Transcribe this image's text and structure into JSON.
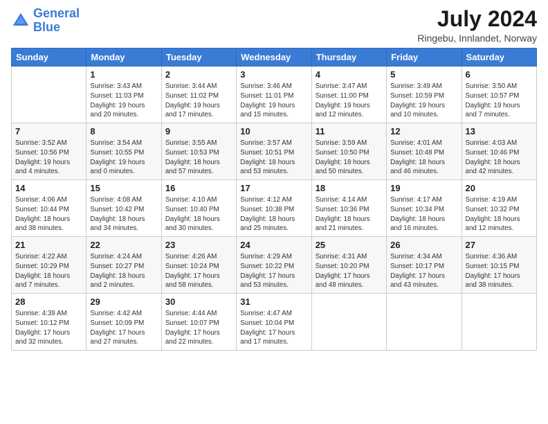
{
  "header": {
    "logo_line1": "General",
    "logo_line2": "Blue",
    "month_year": "July 2024",
    "location": "Ringebu, Innlandet, Norway"
  },
  "weekdays": [
    "Sunday",
    "Monday",
    "Tuesday",
    "Wednesday",
    "Thursday",
    "Friday",
    "Saturday"
  ],
  "weeks": [
    [
      {
        "date": "",
        "info": ""
      },
      {
        "date": "1",
        "info": "Sunrise: 3:43 AM\nSunset: 11:03 PM\nDaylight: 19 hours\nand 20 minutes."
      },
      {
        "date": "2",
        "info": "Sunrise: 3:44 AM\nSunset: 11:02 PM\nDaylight: 19 hours\nand 17 minutes."
      },
      {
        "date": "3",
        "info": "Sunrise: 3:46 AM\nSunset: 11:01 PM\nDaylight: 19 hours\nand 15 minutes."
      },
      {
        "date": "4",
        "info": "Sunrise: 3:47 AM\nSunset: 11:00 PM\nDaylight: 19 hours\nand 12 minutes."
      },
      {
        "date": "5",
        "info": "Sunrise: 3:49 AM\nSunset: 10:59 PM\nDaylight: 19 hours\nand 10 minutes."
      },
      {
        "date": "6",
        "info": "Sunrise: 3:50 AM\nSunset: 10:57 PM\nDaylight: 19 hours\nand 7 minutes."
      }
    ],
    [
      {
        "date": "7",
        "info": "Sunrise: 3:52 AM\nSunset: 10:56 PM\nDaylight: 19 hours\nand 4 minutes."
      },
      {
        "date": "8",
        "info": "Sunrise: 3:54 AM\nSunset: 10:55 PM\nDaylight: 19 hours\nand 0 minutes."
      },
      {
        "date": "9",
        "info": "Sunrise: 3:55 AM\nSunset: 10:53 PM\nDaylight: 18 hours\nand 57 minutes."
      },
      {
        "date": "10",
        "info": "Sunrise: 3:57 AM\nSunset: 10:51 PM\nDaylight: 18 hours\nand 53 minutes."
      },
      {
        "date": "11",
        "info": "Sunrise: 3:59 AM\nSunset: 10:50 PM\nDaylight: 18 hours\nand 50 minutes."
      },
      {
        "date": "12",
        "info": "Sunrise: 4:01 AM\nSunset: 10:48 PM\nDaylight: 18 hours\nand 46 minutes."
      },
      {
        "date": "13",
        "info": "Sunrise: 4:03 AM\nSunset: 10:46 PM\nDaylight: 18 hours\nand 42 minutes."
      }
    ],
    [
      {
        "date": "14",
        "info": "Sunrise: 4:06 AM\nSunset: 10:44 PM\nDaylight: 18 hours\nand 38 minutes."
      },
      {
        "date": "15",
        "info": "Sunrise: 4:08 AM\nSunset: 10:42 PM\nDaylight: 18 hours\nand 34 minutes."
      },
      {
        "date": "16",
        "info": "Sunrise: 4:10 AM\nSunset: 10:40 PM\nDaylight: 18 hours\nand 30 minutes."
      },
      {
        "date": "17",
        "info": "Sunrise: 4:12 AM\nSunset: 10:38 PM\nDaylight: 18 hours\nand 25 minutes."
      },
      {
        "date": "18",
        "info": "Sunrise: 4:14 AM\nSunset: 10:36 PM\nDaylight: 18 hours\nand 21 minutes."
      },
      {
        "date": "19",
        "info": "Sunrise: 4:17 AM\nSunset: 10:34 PM\nDaylight: 18 hours\nand 16 minutes."
      },
      {
        "date": "20",
        "info": "Sunrise: 4:19 AM\nSunset: 10:32 PM\nDaylight: 18 hours\nand 12 minutes."
      }
    ],
    [
      {
        "date": "21",
        "info": "Sunrise: 4:22 AM\nSunset: 10:29 PM\nDaylight: 18 hours\nand 7 minutes."
      },
      {
        "date": "22",
        "info": "Sunrise: 4:24 AM\nSunset: 10:27 PM\nDaylight: 18 hours\nand 2 minutes."
      },
      {
        "date": "23",
        "info": "Sunrise: 4:26 AM\nSunset: 10:24 PM\nDaylight: 17 hours\nand 58 minutes."
      },
      {
        "date": "24",
        "info": "Sunrise: 4:29 AM\nSunset: 10:22 PM\nDaylight: 17 hours\nand 53 minutes."
      },
      {
        "date": "25",
        "info": "Sunrise: 4:31 AM\nSunset: 10:20 PM\nDaylight: 17 hours\nand 48 minutes."
      },
      {
        "date": "26",
        "info": "Sunrise: 4:34 AM\nSunset: 10:17 PM\nDaylight: 17 hours\nand 43 minutes."
      },
      {
        "date": "27",
        "info": "Sunrise: 4:36 AM\nSunset: 10:15 PM\nDaylight: 17 hours\nand 38 minutes."
      }
    ],
    [
      {
        "date": "28",
        "info": "Sunrise: 4:39 AM\nSunset: 10:12 PM\nDaylight: 17 hours\nand 32 minutes."
      },
      {
        "date": "29",
        "info": "Sunrise: 4:42 AM\nSunset: 10:09 PM\nDaylight: 17 hours\nand 27 minutes."
      },
      {
        "date": "30",
        "info": "Sunrise: 4:44 AM\nSunset: 10:07 PM\nDaylight: 17 hours\nand 22 minutes."
      },
      {
        "date": "31",
        "info": "Sunrise: 4:47 AM\nSunset: 10:04 PM\nDaylight: 17 hours\nand 17 minutes."
      },
      {
        "date": "",
        "info": ""
      },
      {
        "date": "",
        "info": ""
      },
      {
        "date": "",
        "info": ""
      }
    ]
  ]
}
